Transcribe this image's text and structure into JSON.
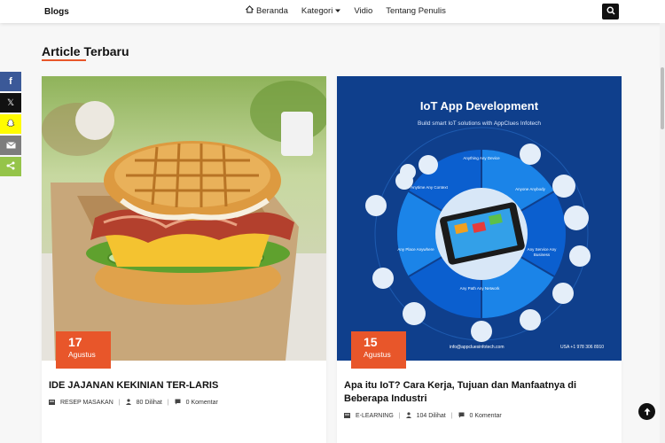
{
  "header": {
    "brand": "Blogs",
    "nav": [
      {
        "label": "Beranda"
      },
      {
        "label": "Kategori"
      },
      {
        "label": "Vidio"
      },
      {
        "label": "Tentang Penulis"
      }
    ]
  },
  "section": {
    "title": "Article Terbaru"
  },
  "share_buttons": [
    "facebook-icon",
    "x-icon",
    "snapchat-icon",
    "email-icon",
    "share-icon"
  ],
  "colors": {
    "accent": "#e8562a",
    "facebook": "#3b5998",
    "x": "#111111",
    "snapchat": "#fffc00",
    "email": "#7d7d7d",
    "share": "#95c44a"
  },
  "articles": [
    {
      "day": "17",
      "month": "Agustus",
      "title": "IDE JAJANAN KEKINIAN TER-LARIS",
      "category": "RESEP MASAKAN",
      "views": "80 Dilihat",
      "comments": "0 Komentar"
    },
    {
      "day": "15",
      "month": "Agustus",
      "title": "Apa itu IoT? Cara Kerja, Tujuan dan Manfaatnya di Beberapa Industri",
      "category": "E-LEARNING",
      "views": "104 Dilihat",
      "comments": "0 Komentar",
      "image_text": {
        "title": "IoT App Development",
        "subtitle": "Build smart IoT solutions with AppClues Infotech",
        "segments": [
          "Anything Any Device",
          "Anyone Anybody",
          "Any Service Any Business",
          "Any Path Any Network",
          "Any Place Anywhere",
          "Anytime Any Context"
        ],
        "email": "info@appcluesinfotech.com",
        "phone": "USA +1 978 306 8910"
      }
    }
  ]
}
